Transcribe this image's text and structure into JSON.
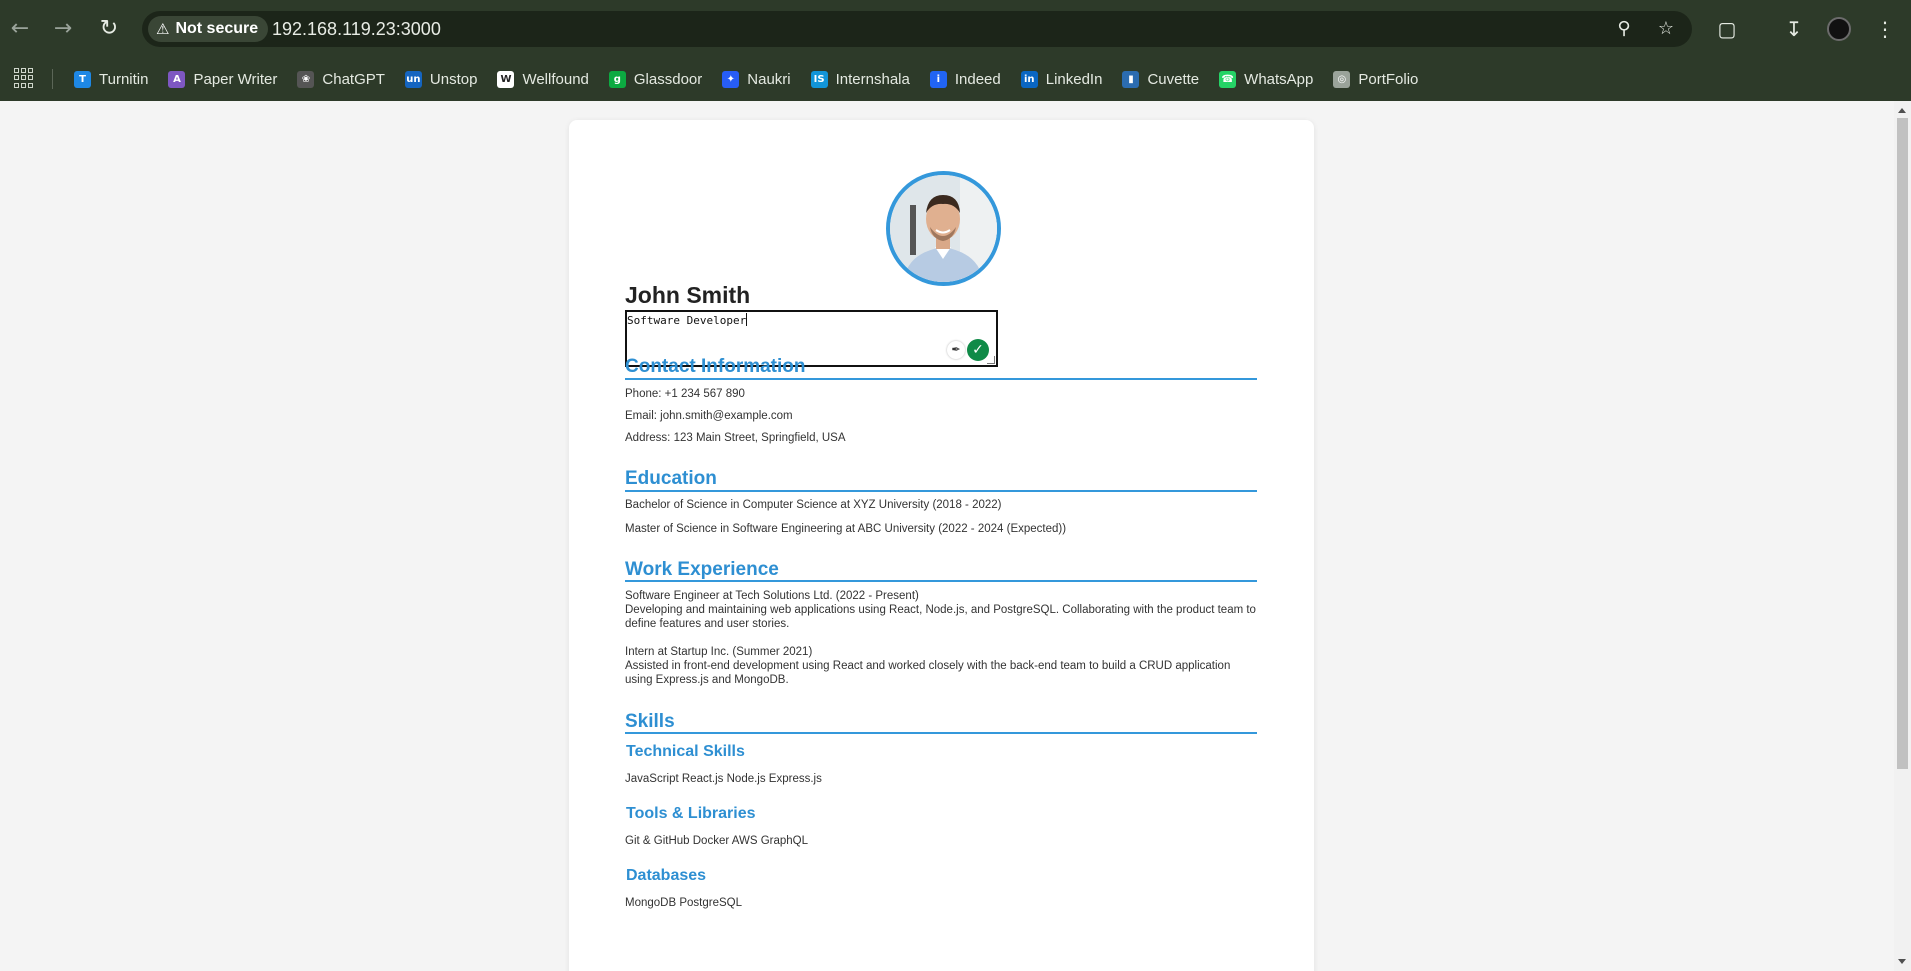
{
  "browser": {
    "security_label": "Not secure",
    "url": "192.168.119.23:3000",
    "bookmarks": [
      {
        "label": "Turnitin",
        "icon": "turnitin-icon",
        "color": "#1e88e5"
      },
      {
        "label": "Paper Writer",
        "icon": "paper-writer-icon",
        "color": "#7e57c2"
      },
      {
        "label": "ChatGPT",
        "icon": "chatgpt-icon",
        "color": "#555555"
      },
      {
        "label": "Unstop",
        "icon": "unstop-icon",
        "color": "#1565c0"
      },
      {
        "label": "Wellfound",
        "icon": "wellfound-icon",
        "color": "#ffffff"
      },
      {
        "label": "Glassdoor",
        "icon": "glassdoor-icon",
        "color": "#0caa41"
      },
      {
        "label": "Naukri",
        "icon": "naukri-icon",
        "color": "#275df5"
      },
      {
        "label": "Internshala",
        "icon": "internshala-icon",
        "color": "#1295d8"
      },
      {
        "label": "Indeed",
        "icon": "indeed-icon",
        "color": "#2164f3"
      },
      {
        "label": "LinkedIn",
        "icon": "linkedin-icon",
        "color": "#0a66c2"
      },
      {
        "label": "Cuvette",
        "icon": "cuvette-icon",
        "color": "#2b6cb0"
      },
      {
        "label": "WhatsApp",
        "icon": "whatsapp-icon",
        "color": "#25d366"
      },
      {
        "label": "PortFolio",
        "icon": "globe-icon",
        "color": "#9aa39a"
      }
    ]
  },
  "resume": {
    "name": "John Smith",
    "title": "Software Developer",
    "contact": {
      "heading": "Contact Information",
      "phone": "Phone: +1 234 567 890",
      "email": "Email: john.smith@example.com",
      "address": "Address: 123 Main Street, Springfield, USA"
    },
    "education": {
      "heading": "Education",
      "items": [
        "Bachelor of Science in Computer Science at XYZ University (2018 - 2022)",
        "Master of Science in Software Engineering at ABC University (2022 - 2024 (Expected))"
      ]
    },
    "work": {
      "heading": "Work Experience",
      "items": [
        {
          "role": "Software Engineer at Tech Solutions Ltd. (2022 - Present)",
          "description": "Developing and maintaining web applications using React, Node.js, and PostgreSQL. Collaborating with the product team to define features and user stories."
        },
        {
          "role": "Intern at Startup Inc. (Summer 2021)",
          "description": "Assisted in front-end development using React and worked closely with the back-end team to build a CRUD application using Express.js and MongoDB."
        }
      ]
    },
    "skills": {
      "heading": "Skills",
      "technical": {
        "heading": "Technical Skills",
        "items": "JavaScript React.js Node.js Express.js"
      },
      "tools": {
        "heading": "Tools & Libraries",
        "items": "Git & GitHub Docker AWS GraphQL"
      },
      "databases": {
        "heading": "Databases",
        "items": "MongoDB PostgreSQL"
      }
    }
  },
  "colors": {
    "accent": "#3498db",
    "chrome": "#2d3a29",
    "confirm": "#0f8a47"
  }
}
